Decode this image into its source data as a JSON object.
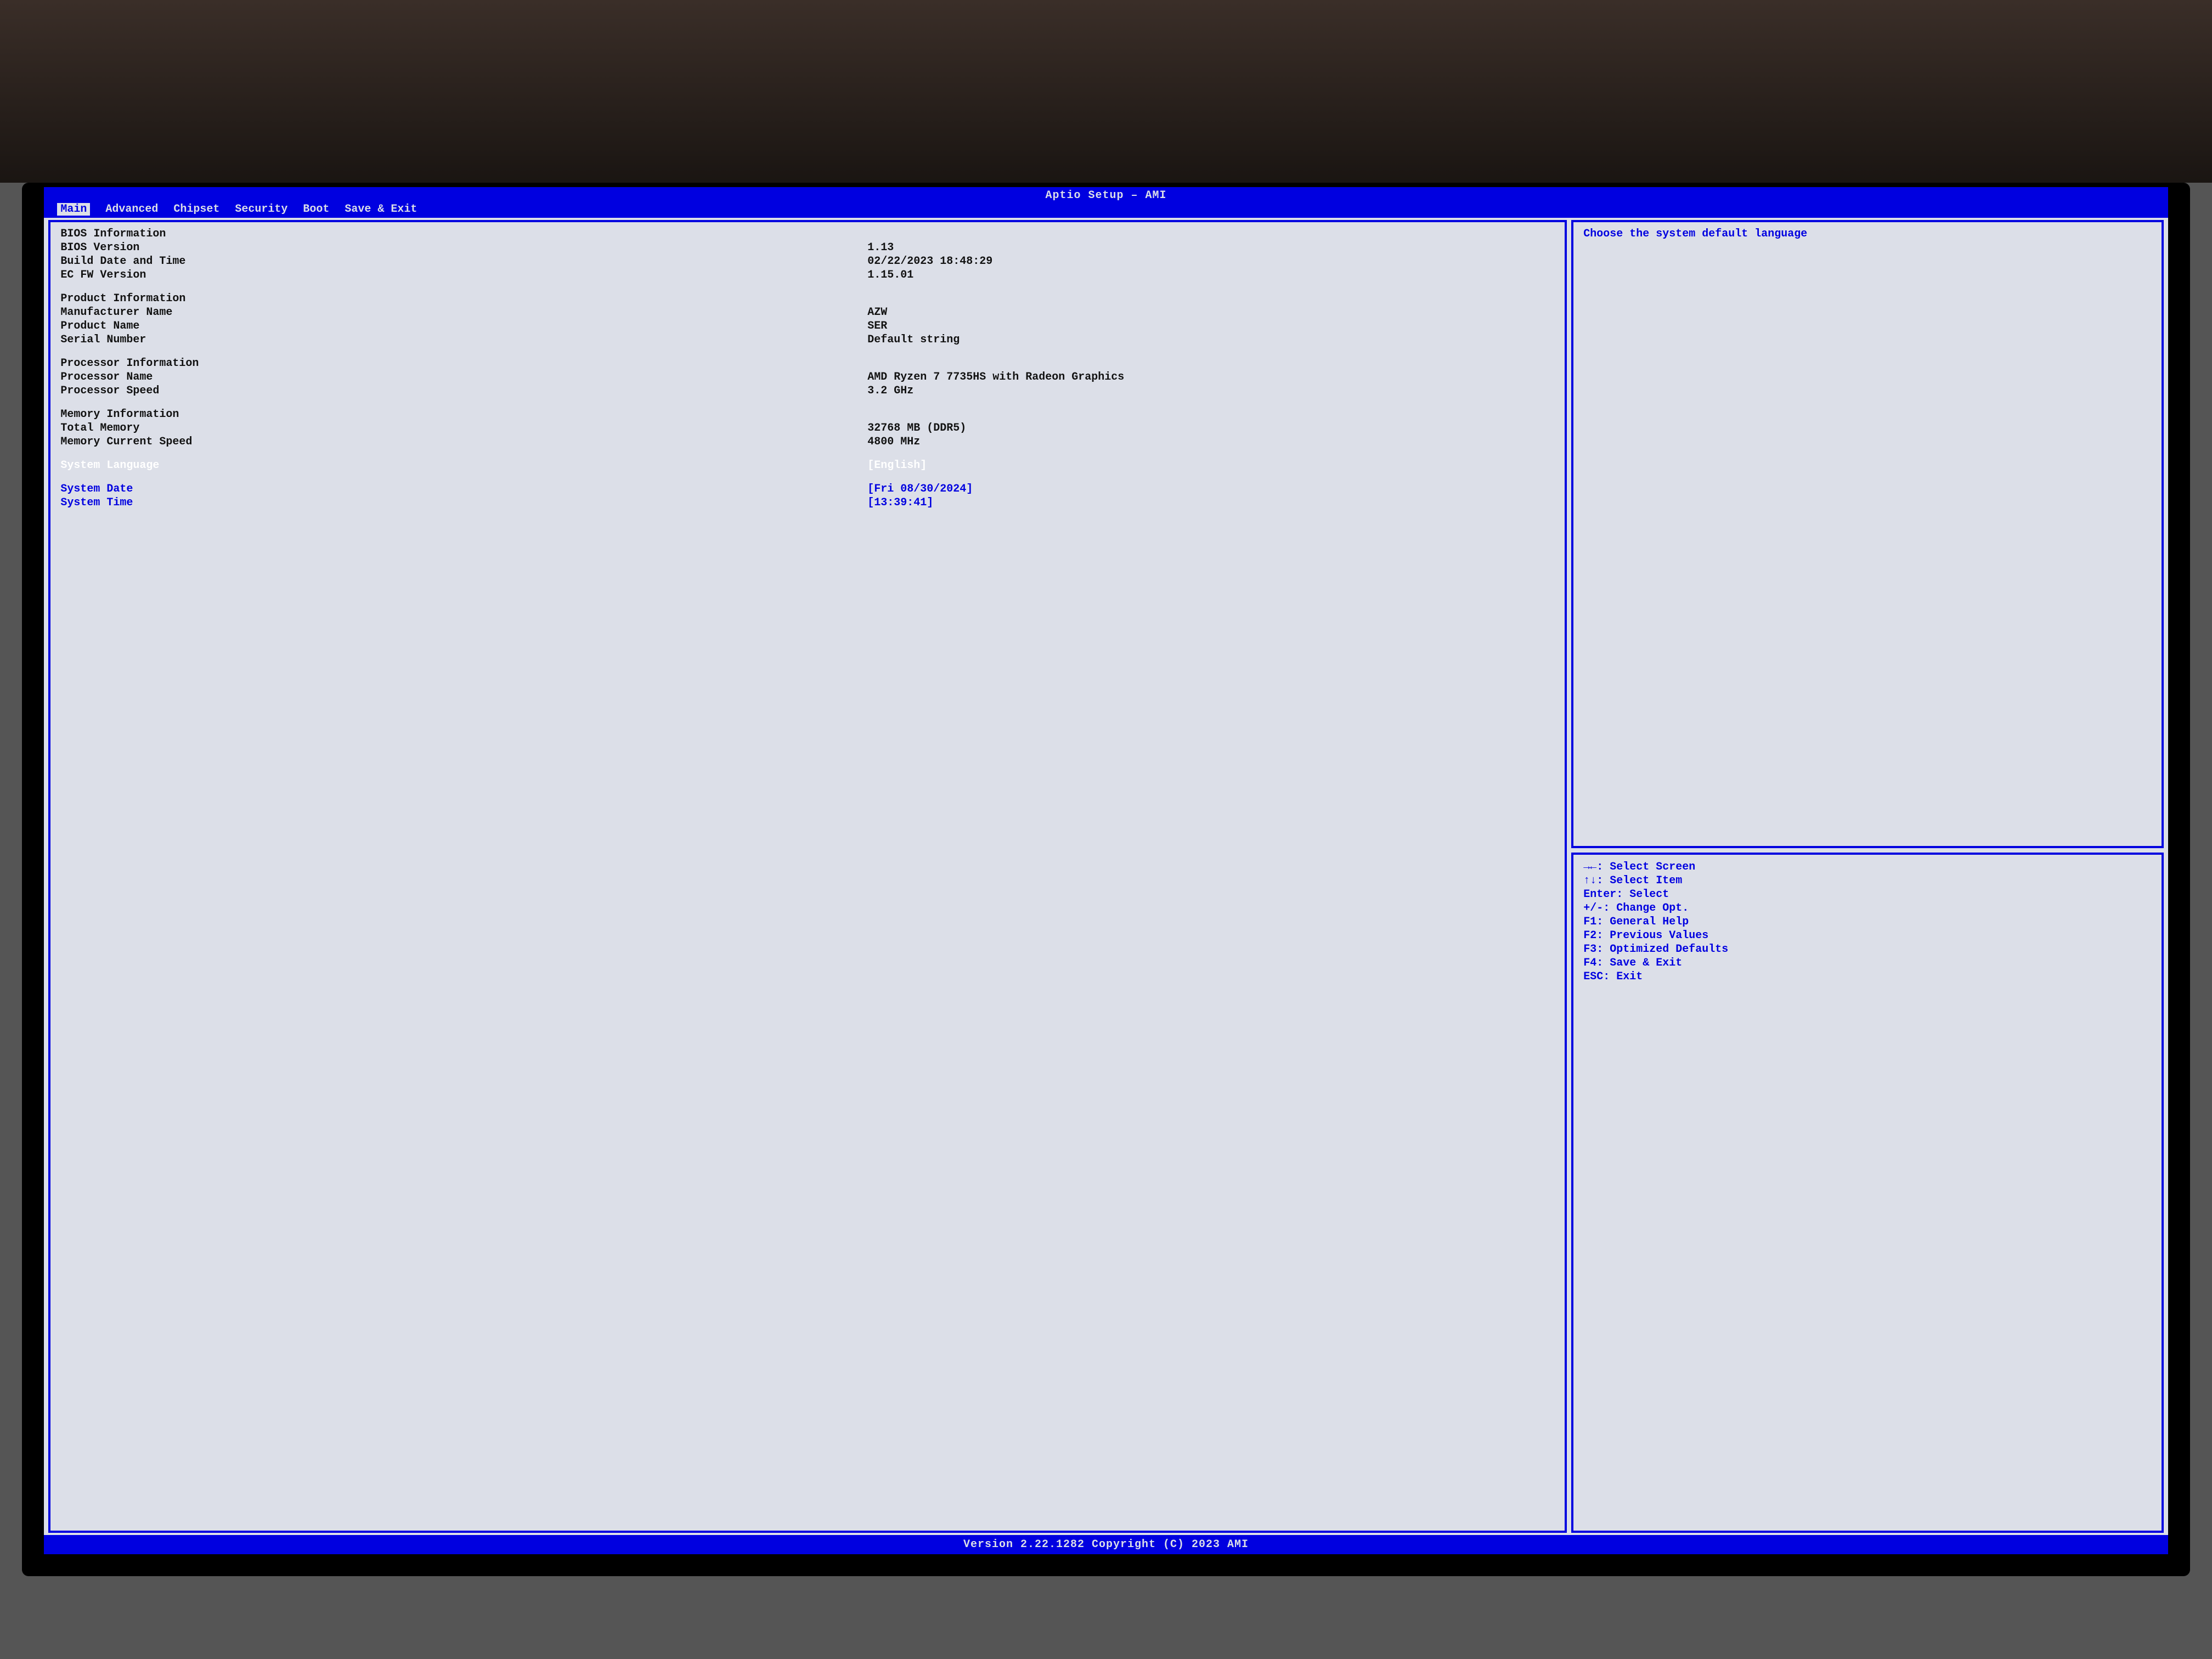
{
  "header": {
    "title": "Aptio Setup – AMI"
  },
  "tabs": [
    "Main",
    "Advanced",
    "Chipset",
    "Security",
    "Boot",
    "Save & Exit"
  ],
  "active_tab_index": 0,
  "main": {
    "bios_info_header": "BIOS Information",
    "bios_version_label": "BIOS Version",
    "bios_version": "1.13",
    "build_date_label": "Build Date and Time",
    "build_date": "02/22/2023 18:48:29",
    "ec_fw_label": "EC FW Version",
    "ec_fw": "1.15.01",
    "product_info_header": "Product Information",
    "mfr_label": "Manufacturer Name",
    "mfr": "AZW",
    "product_label": "Product Name",
    "product": "SER",
    "serial_label": "Serial Number",
    "serial": "Default string",
    "cpu_info_header": "Processor Information",
    "cpu_name_label": "Processor Name",
    "cpu_name": "AMD Ryzen 7 7735HS with Radeon Graphics",
    "cpu_speed_label": "Processor Speed",
    "cpu_speed": "3.2 GHz",
    "mem_info_header": "Memory Information",
    "mem_total_label": "Total Memory",
    "mem_total": "32768 MB (DDR5)",
    "mem_speed_label": "Memory Current Speed",
    "mem_speed": "4800 MHz",
    "lang_label": "System Language",
    "lang_value": "[English]",
    "date_label": "System Date",
    "date_value": "[Fri 08/30/2024]",
    "time_label": "System Time",
    "time_value": "[13:39:41]"
  },
  "help": {
    "text": "Choose the system default language"
  },
  "keys": {
    "l1": "→←: Select Screen",
    "l2": "↑↓: Select Item",
    "l3": "Enter: Select",
    "l4": "+/-: Change Opt.",
    "l5": "F1: General Help",
    "l6": "F2: Previous Values",
    "l7": "F3: Optimized Defaults",
    "l8": "F4: Save & Exit",
    "l9": "ESC: Exit"
  },
  "footer": {
    "text": "Version 2.22.1282 Copyright (C) 2023 AMI"
  }
}
